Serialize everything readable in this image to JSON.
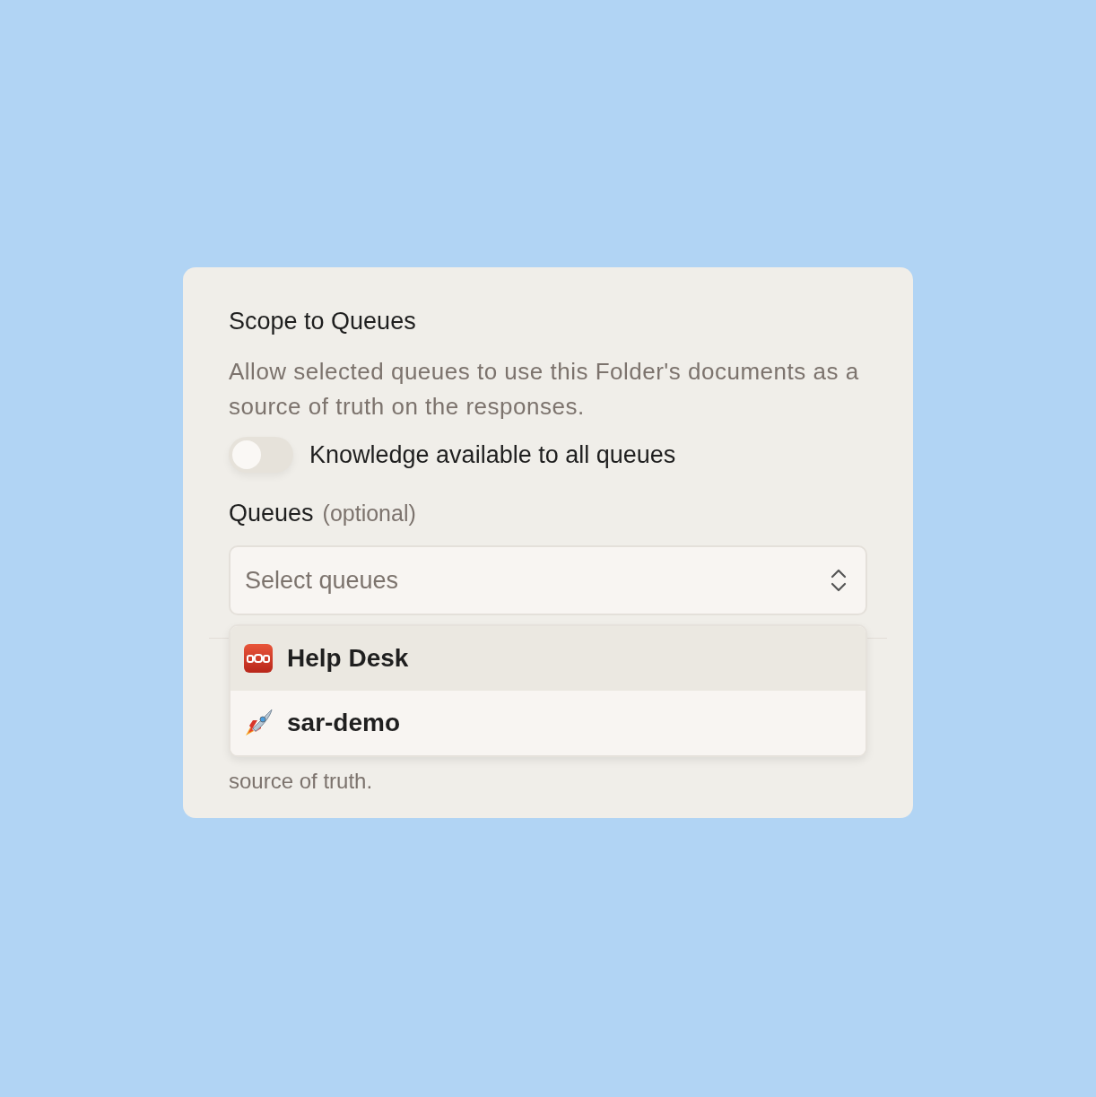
{
  "section": {
    "title": "Scope to Queues",
    "description": "Allow selected queues to use this Folder's documents as a source of truth on the responses."
  },
  "toggle": {
    "label": "Knowledge available to all queues",
    "on": false
  },
  "queues_field": {
    "label": "Queues",
    "hint": "(optional)",
    "placeholder": "Select queues"
  },
  "dropdown": {
    "items": [
      {
        "label": "Help Desk",
        "kind": "sos",
        "selected": true
      },
      {
        "label": "sar-demo",
        "kind": "rocket",
        "selected": false
      }
    ]
  },
  "covered_text": "source of truth."
}
